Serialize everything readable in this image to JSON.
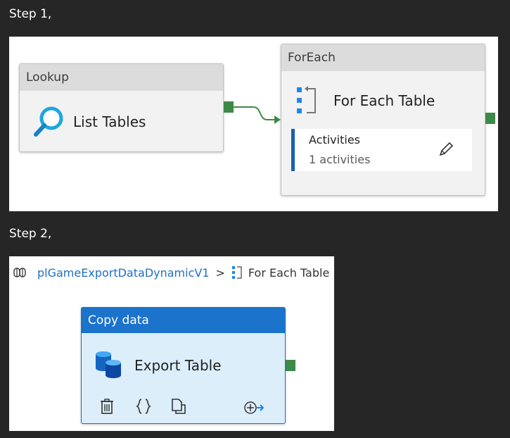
{
  "step1": {
    "label": "Step 1,",
    "lookup": {
      "type": "Lookup",
      "title": "List Tables"
    },
    "foreach": {
      "type": "ForEach",
      "title": "For Each Table",
      "activities": {
        "label": "Activities",
        "count": "1 activities"
      }
    }
  },
  "step2": {
    "label": "Step 2,",
    "breadcrumb": {
      "pipeline": "plGameExportDataDynamicV1",
      "separator": ">",
      "current": "For Each Table"
    },
    "copy_data": {
      "type": "Copy data",
      "title": "Export Table",
      "toolbar": [
        "delete-icon",
        "code-icon",
        "copy-icon",
        "add-output-icon"
      ]
    }
  },
  "colors": {
    "port": "#3d8a48",
    "accent": "#1b73cc",
    "link": "#1e6fc6"
  }
}
